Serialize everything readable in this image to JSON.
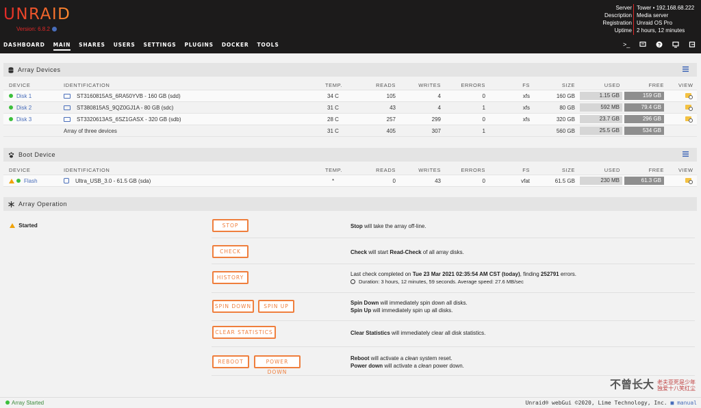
{
  "header": {
    "logo": "UNRAID",
    "version": "Version: 6.8.2",
    "server_info": {
      "labels": [
        "Server",
        "Description",
        "Registration",
        "Uptime"
      ],
      "values": [
        "Tower • 192.168.68.222",
        "Media server",
        "Unraid OS Pro",
        "2 hours, 12 minutes"
      ]
    },
    "nav": [
      "DASHBOARD",
      "MAIN",
      "SHARES",
      "USERS",
      "SETTINGS",
      "PLUGINS",
      "DOCKER",
      "TOOLS"
    ],
    "nav_active": "MAIN"
  },
  "array_devices": {
    "title": "Array Devices",
    "columns": [
      "DEVICE",
      "IDENTIFICATION",
      "TEMP.",
      "READS",
      "WRITES",
      "ERRORS",
      "FS",
      "SIZE",
      "USED",
      "FREE",
      "VIEW"
    ],
    "rows": [
      {
        "device": "Disk 1",
        "id": "ST3160815AS_6RA50YVB - 160 GB (sdd)",
        "temp": "34 C",
        "reads": "105",
        "writes": "4",
        "errors": "0",
        "fs": "xfs",
        "size": "160 GB",
        "used": "1.15 GB",
        "used_pct": 1,
        "free": "159 GB",
        "free_pct": 99
      },
      {
        "device": "Disk 2",
        "id": "ST380815AS_9QZ0GJ1A - 80 GB (sdc)",
        "temp": "31 C",
        "reads": "43",
        "writes": "4",
        "errors": "1",
        "fs": "xfs",
        "size": "80 GB",
        "used": "592 MB",
        "used_pct": 1,
        "free": "79.4 GB",
        "free_pct": 99
      },
      {
        "device": "Disk 3",
        "id": "ST3320613AS_6SZ1GASX - 320 GB (sdb)",
        "temp": "28 C",
        "reads": "257",
        "writes": "299",
        "errors": "0",
        "fs": "xfs",
        "size": "320 GB",
        "used": "23.7 GB",
        "used_pct": 7,
        "free": "296 GB",
        "free_pct": 93
      }
    ],
    "summary": {
      "id": "Array of three devices",
      "temp": "31 C",
      "reads": "405",
      "writes": "307",
      "errors": "1",
      "size": "560 GB",
      "used": "25.5 GB",
      "used_pct": 5,
      "free": "534 GB",
      "free_pct": 95
    }
  },
  "boot_device": {
    "title": "Boot Device",
    "columns": [
      "DEVICE",
      "IDENTIFICATION",
      "TEMP.",
      "READS",
      "WRITES",
      "ERRORS",
      "FS",
      "SIZE",
      "USED",
      "FREE",
      "VIEW"
    ],
    "row": {
      "device": "Flash",
      "id": "Ultra_USB_3.0 - 61.5 GB (sda)",
      "temp": "*",
      "reads": "0",
      "writes": "43",
      "errors": "0",
      "fs": "vfat",
      "size": "61.5 GB",
      "used": "230 MB",
      "used_pct": 1,
      "free": "61.3 GB",
      "free_pct": 99
    }
  },
  "array_operation": {
    "title": "Array Operation",
    "status": "Started",
    "buttons": {
      "stop": "STOP",
      "check": "CHECK",
      "history": "HISTORY",
      "spin_down": "SPIN DOWN",
      "spin_up": "SPIN UP",
      "clear_statistics": "CLEAR STATISTICS",
      "reboot": "REBOOT",
      "power_down": "POWER DOWN"
    },
    "descriptions": {
      "stop_b": "Stop",
      "stop_t": " will take the array off-line.",
      "check_b": "Check",
      "check_t1": " will start ",
      "check_b2": "Read-Check",
      "check_t2": " of all array disks.",
      "history_t1": "Last check completed on ",
      "history_b": "Tue 23 Mar 2021 02:35:54 AM CST (today)",
      "history_t2": ", finding ",
      "history_b2": "252791",
      "history_t3": " errors.",
      "history_duration": "Duration: 3 hours, 12 minutes, 59 seconds. Average speed: 27.6 MB/sec",
      "spin_down_b": "Spin Down",
      "spin_down_t": " will immediately spin down all disks.",
      "spin_up_b": "Spin Up",
      "spin_up_t": " will immediately spin up all disks.",
      "clear_b": "Clear Statistics",
      "clear_t": " will immediately clear all disk statistics.",
      "reboot_b": "Reboot",
      "reboot_t1": " will activate a ",
      "reboot_i": "clean",
      "reboot_t2": " system reset.",
      "power_b": "Power down",
      "power_t1": " will activate a ",
      "power_i": "clean",
      "power_t2": " power down."
    }
  },
  "footer": {
    "status": "Array Started",
    "copyright": "Unraid® webGui ©2020, Lime Technology, Inc.",
    "manual": "manual"
  },
  "watermark": {
    "main": "不曾长大",
    "line1": "老夫亚死是少年",
    "line2": "独爱十八笑红尘"
  },
  "colors": {
    "accent": "#ef7e3c",
    "brand": "#e22828",
    "link": "#486dba",
    "ok": "#3cbf3c"
  }
}
